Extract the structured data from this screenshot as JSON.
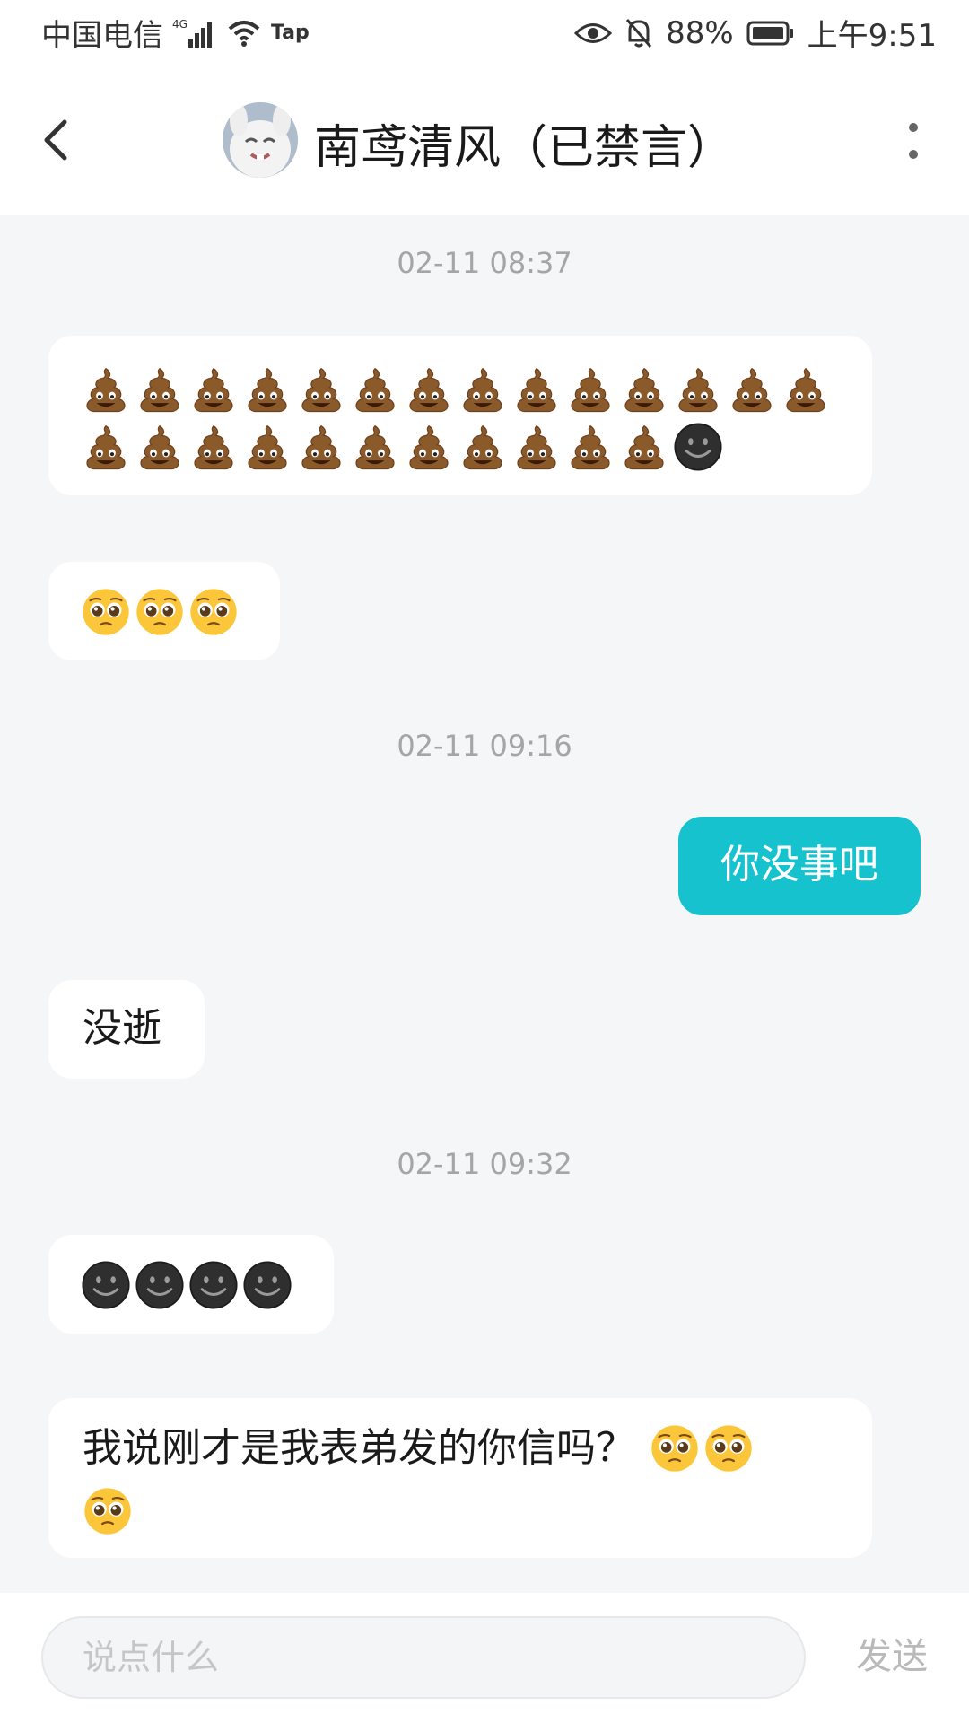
{
  "status_bar": {
    "carrier": "中国电信",
    "network": "4G",
    "app_badge": "Tap",
    "battery": "88%",
    "time": "上午9:51"
  },
  "header": {
    "title": "南鸢清风（已禁言）"
  },
  "messages": [
    {
      "type": "timestamp",
      "text": "02-11 08:37"
    },
    {
      "type": "incoming",
      "emoji": "poop x25, new-moon-face x1"
    },
    {
      "type": "incoming",
      "emoji": "pleading-face x3"
    },
    {
      "type": "timestamp",
      "text": "02-11 09:16"
    },
    {
      "type": "outgoing",
      "text": "你没事吧"
    },
    {
      "type": "incoming",
      "text": "没逝"
    },
    {
      "type": "timestamp",
      "text": "02-11 09:32"
    },
    {
      "type": "incoming",
      "emoji": "new-moon-face x4"
    },
    {
      "type": "incoming",
      "text": "我说刚才是我表弟发的你信吗？"
    }
  ],
  "ts1": "02-11 08:37",
  "ts2": "02-11 09:16",
  "ts3": "02-11 09:32",
  "msg_out_1": "你没事吧",
  "msg_in_text_1": "没逝",
  "msg_in_text_2": "我说刚才是我表弟发的你信吗？",
  "input": {
    "placeholder": "说点什么",
    "send_label": "发送"
  },
  "colors": {
    "accent": "#17c2cf",
    "background": "#f5f6f8",
    "bubble": "#ffffff"
  },
  "icons": [
    "back-arrow-icon",
    "more-vertical-icon",
    "eye-icon",
    "bell-off-icon",
    "battery-icon",
    "wifi-icon",
    "signal-icon",
    "poop-emoji",
    "pleading-face-emoji",
    "new-moon-face-emoji"
  ]
}
